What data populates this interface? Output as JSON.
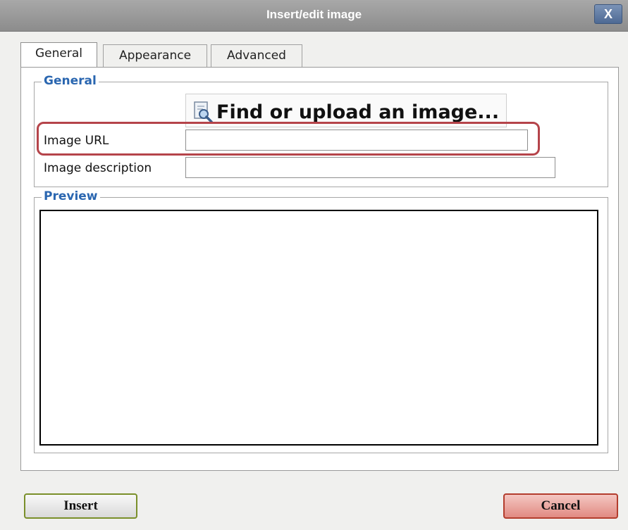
{
  "window": {
    "title": "Insert/edit image",
    "close_label": "X"
  },
  "tabs": [
    {
      "label": "General",
      "active": true
    },
    {
      "label": "Appearance",
      "active": false
    },
    {
      "label": "Advanced",
      "active": false
    }
  ],
  "general": {
    "legend": "General",
    "find_button_label": "Find or upload an image...",
    "image_url_label": "Image URL",
    "image_url_value": "",
    "image_description_label": "Image description",
    "image_description_value": ""
  },
  "preview": {
    "legend": "Preview"
  },
  "buttons": {
    "insert_label": "Insert",
    "cancel_label": "Cancel"
  },
  "colors": {
    "legend": "#2a66b0",
    "highlight": "#b5444a",
    "insert_border": "#7a8f2a",
    "cancel_fill": "#e18a82"
  },
  "icons": {
    "find": "magnifier-on-document-icon",
    "close": "close-icon"
  }
}
